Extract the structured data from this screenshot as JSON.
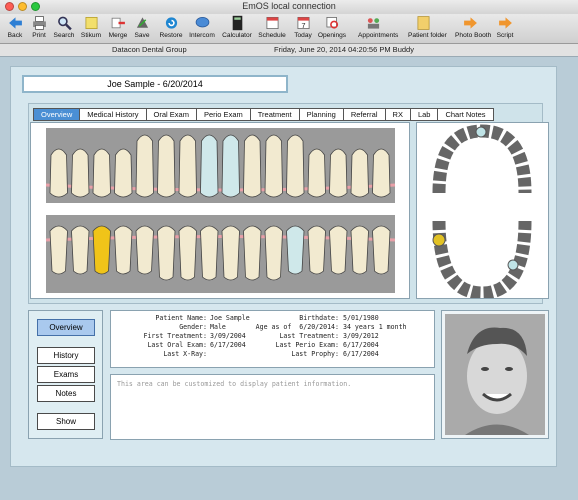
{
  "window": {
    "title": "EmOS local connection"
  },
  "toolbar": {
    "items": [
      {
        "label": "Back",
        "icon": "back-arrow-icon"
      },
      {
        "label": "Print",
        "icon": "printer-icon"
      },
      {
        "label": "Search",
        "icon": "magnifier-icon"
      },
      {
        "label": "Stikum",
        "icon": "sticky-note-icon"
      },
      {
        "label": "Merge",
        "icon": "merge-icon"
      },
      {
        "label": "Save",
        "icon": "save-icon"
      },
      {
        "label": "Restore",
        "icon": "restore-icon"
      },
      {
        "label": "Intercom",
        "icon": "speech-bubble-icon"
      },
      {
        "label": "Calculator",
        "icon": "calculator-icon"
      },
      {
        "label": "Schedule",
        "icon": "schedule-icon"
      },
      {
        "label": "Today",
        "icon": "calendar-icon"
      },
      {
        "label": "Openings",
        "icon": "openings-icon"
      },
      {
        "label": "Appointments",
        "icon": "appointments-icon"
      },
      {
        "label": "Patient folder",
        "icon": "folder-icon"
      },
      {
        "label": "Photo Booth",
        "icon": "forward-arrow-icon"
      },
      {
        "label": "Script",
        "icon": "forward-arrow-icon"
      }
    ]
  },
  "infobar": {
    "practice": "Datacon Dental Group",
    "datetime": "Friday, June 20, 2014   04:20:56 PM   Buddy"
  },
  "patient_header": "Joe Sample -  6/20/2014",
  "tabs": [
    "Overview",
    "Medical History",
    "Oral Exam",
    "Perio Exam",
    "Treatment",
    "Planning",
    "Referral",
    "RX",
    "Lab",
    "Chart Notes"
  ],
  "side_buttons": {
    "overview": "Overview",
    "history": "History",
    "exams": "Exams",
    "notes": "Notes",
    "show": "Show"
  },
  "patient_info": {
    "left": [
      {
        "label": "Patient Name:",
        "value": "Joe Sample"
      },
      {
        "label": "Gender:",
        "value": "Male"
      },
      {
        "label": "First Treatment:",
        "value": "3/09/2004"
      },
      {
        "label": "Last Oral Exam:",
        "value": "6/17/2004"
      },
      {
        "label": "Last X-Ray:",
        "value": ""
      }
    ],
    "right": [
      {
        "label": "Birthdate:",
        "value": "5/01/1980"
      },
      {
        "label": "Age as of  6/20/2014:",
        "value": "34 years 1 month"
      },
      {
        "label": "Last Treatment:",
        "value": "3/09/2012"
      },
      {
        "label": "Last Perio Exam:",
        "value": "6/17/2004"
      },
      {
        "label": "Last Prophy:",
        "value": "6/17/2004"
      }
    ]
  },
  "custom_note": "This area can be customized to display patient information."
}
